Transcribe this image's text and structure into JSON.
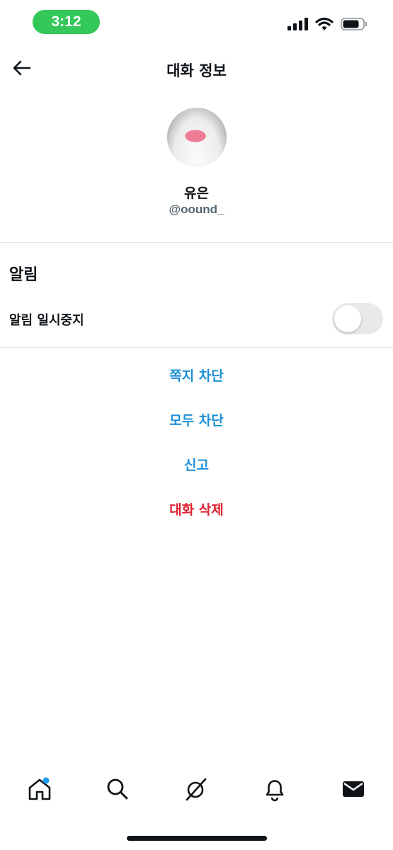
{
  "status_bar": {
    "time": "3:12"
  },
  "header": {
    "title": "대화 정보"
  },
  "profile": {
    "name": "유은",
    "handle": "@oound_"
  },
  "notifications": {
    "section_title": "알림",
    "pause_label": "알림 일시중지",
    "pause_enabled": false
  },
  "actions": {
    "block_dm": "쪽지 차단",
    "block_all": "모두 차단",
    "report": "신고",
    "delete_conversation": "대화 삭제"
  },
  "colors": {
    "link_blue": "#1d8fd6",
    "danger_red": "#e0202f",
    "status_green": "#34c759",
    "badge_blue": "#1d9bf0"
  },
  "tab_bar": {
    "icons": [
      "home-icon",
      "search-icon",
      "grok-icon",
      "bell-icon",
      "mail-icon"
    ],
    "home_badge": true
  }
}
